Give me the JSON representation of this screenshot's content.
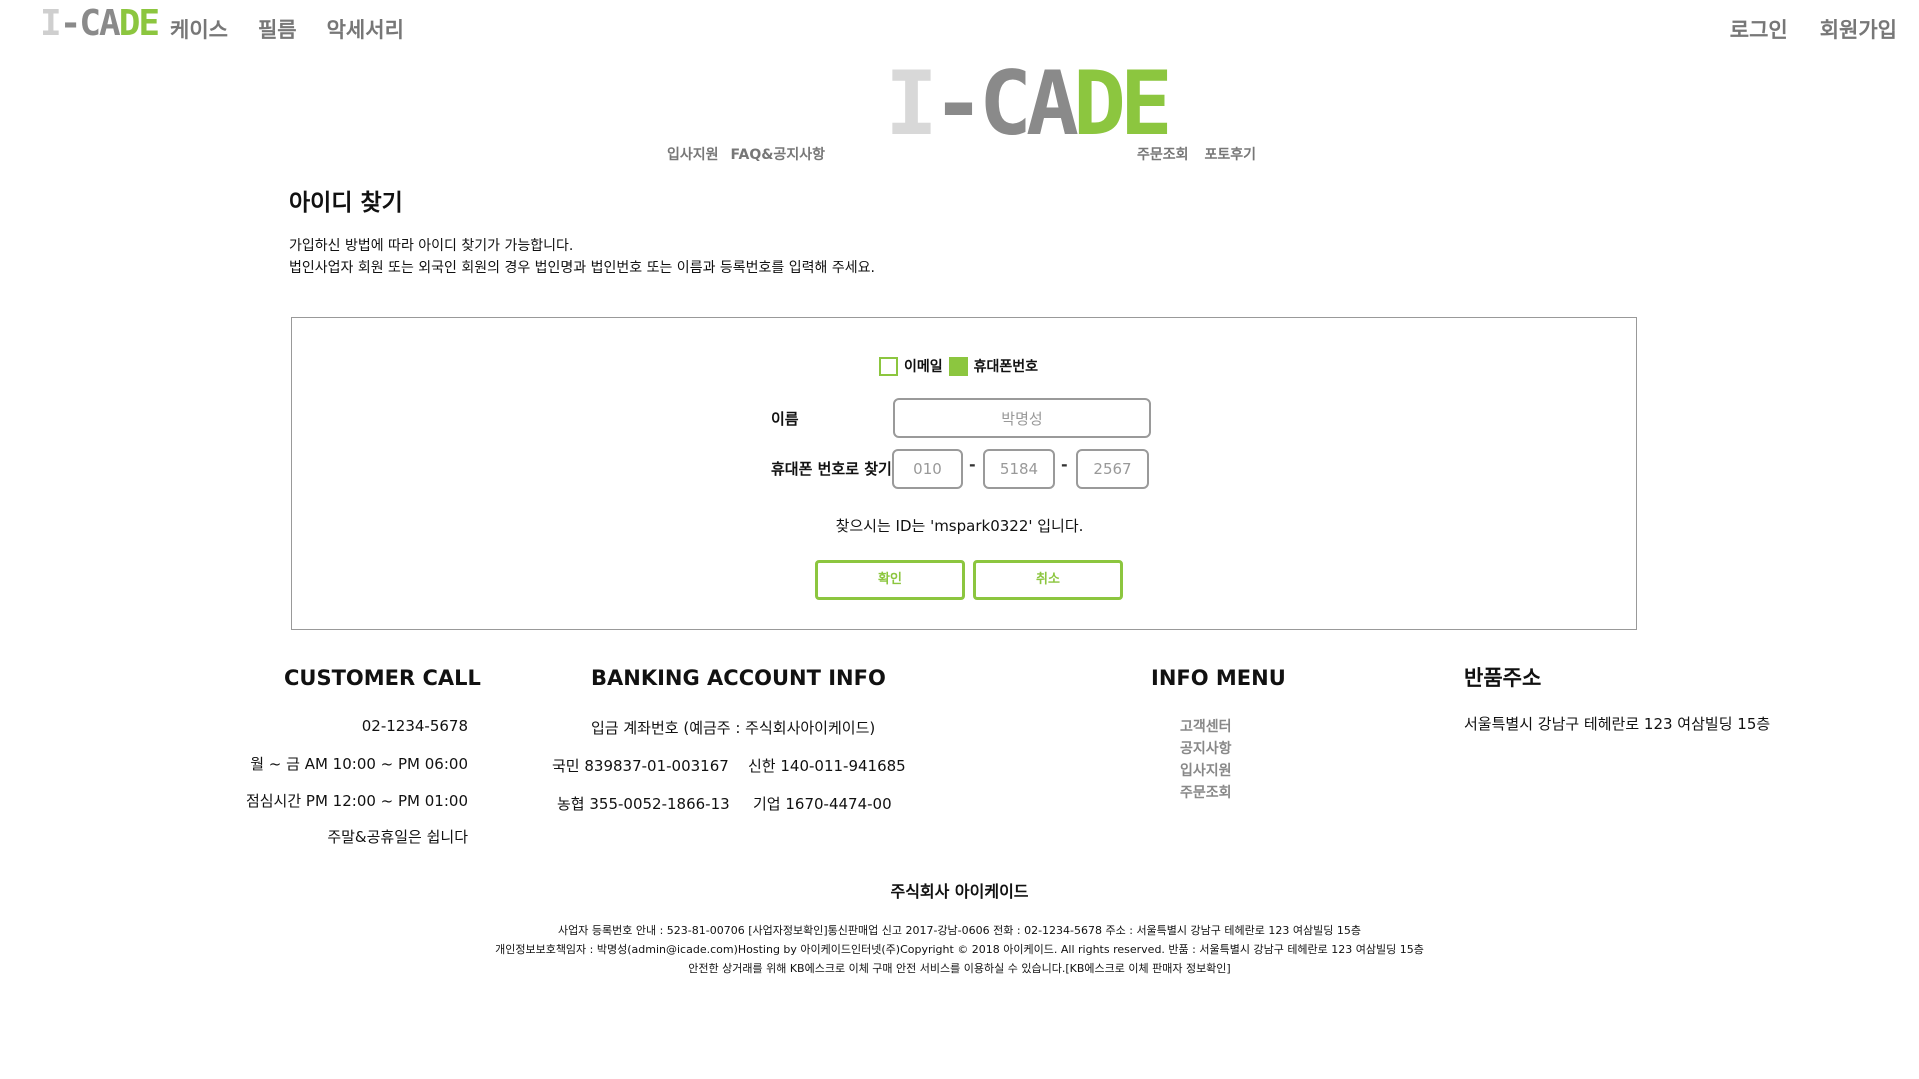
{
  "brand": {
    "logo_parts": [
      "I",
      "-CA",
      "DE"
    ],
    "colors": {
      "light": "#cfcfcf",
      "dark": "#8a8a8a",
      "accent": "#8cc63f"
    }
  },
  "top_nav": [
    "케이스",
    "필름",
    "악세서리"
  ],
  "auth": {
    "login": "로그인",
    "signup": "회원가입"
  },
  "sub_nav": {
    "left": [
      "입사지원",
      "FAQ&공지사항"
    ],
    "right": [
      "주문조회",
      "포토후기"
    ]
  },
  "page": {
    "title": "아이디 찾기",
    "desc_line1": "가입하신 방법에 따라 아이디 찾기가 가능합니다.",
    "desc_line2": "법인사업자 회원 또는 외국인 회원의 경우 법인명과 법인번호 또는 이름과 등록번호를 입력해 주세요."
  },
  "form": {
    "options": [
      {
        "label": "이메일",
        "selected": false
      },
      {
        "label": "휴대폰번호",
        "selected": true
      }
    ],
    "name_label": "이름",
    "name_value": "박명성",
    "phone_label": "휴대폰 번호로 찾기",
    "phone": [
      "010",
      "5184",
      "2567"
    ],
    "dash": "-",
    "result": "찾으시는 ID는 'mspark0322' 입니다.",
    "confirm": "확인",
    "cancel": "취소"
  },
  "footer": {
    "customer_call": {
      "heading": "CUSTOMER CALL",
      "lines": [
        "02-1234-5678",
        "월 ~ 금 AM 10:00 ~ PM 06:00",
        "점심시간 PM 12:00 ~ PM 01:00",
        "주말&공휴일은 쉽니다"
      ]
    },
    "banking": {
      "heading": "BANKING ACCOUNT INFO",
      "holder": "입금 계좌번호 (예금주 : 주식회사아이케이드)",
      "row1_a": "국민 839837-01-003167",
      "row1_b": "신한 140-011-941685",
      "row2_a": "농협 355-0052-1866-13",
      "row2_b": "기업 1670-4474-00"
    },
    "info_menu": {
      "heading": "INFO MENU",
      "items": [
        "고객센터",
        "공지사항",
        "입사지원",
        "주문조회"
      ]
    },
    "return": {
      "heading": "반품주소",
      "address": "서울특별시 강남구 테헤란로 123 여삼빌딩 15층"
    },
    "company": "주식회사 아이케이드",
    "legal": [
      "사업자 등록번호 안내 : 523-81-00706 [사업자정보확인]통신판매업 신고 2017-강남-0606 전화 : 02-1234-5678 주소 : 서울특별시 강남구 테헤란로 123 여삼빌딩 15층",
      "개인정보보호책임자 : 박명성(admin@icade.com)Hosting by 아이케이드인터넷(주)Copyright © 2018 아이케이드. All rights reserved. 반품 : 서울특별시 강남구 테헤란로 123 여삼빌딩 15층",
      "안전한 상거래를 위해 KB에스크로 이체 구매 안전 서비스를 이용하실 수 있습니다.[KB에스크로 이체 판매자 정보확인]"
    ]
  }
}
